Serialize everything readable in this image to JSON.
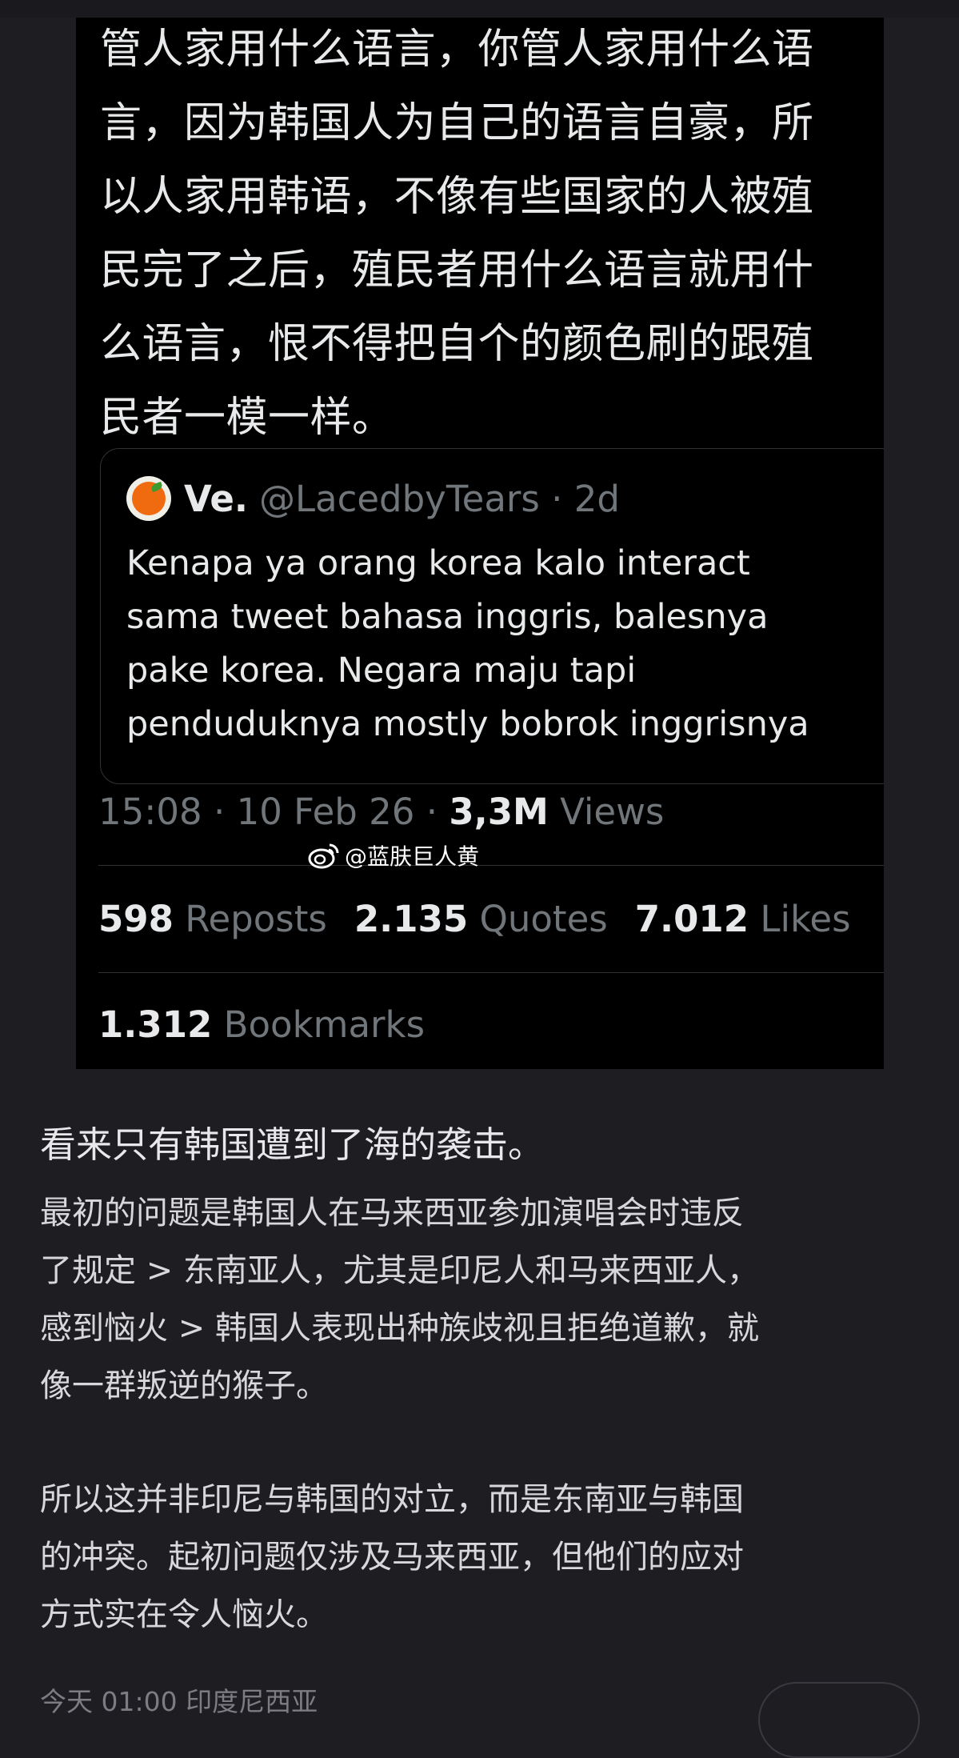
{
  "tweet": {
    "text": "管人家用什么语言，你管人家用什么语\n言，因为韩国人为自己的语言自豪，所\n以人家用韩语，不像有些国家的人被殖\n民完了之后，殖民者用什么语言就用什\n么语言，恨不得把自个的颜色刷的跟殖\n民者一模一样。",
    "quote": {
      "name": "Ve.",
      "handle": "@LacedbyTears · 2d",
      "text": "Kenapa ya orang korea kalo interact\nsama tweet bahasa inggris, balesnya\npake korea. Negara maju tapi\npenduduknya mostly bobrok inggrisnya",
      "avatar_icon": "orange-fruit-avatar"
    },
    "meta": {
      "time": "15:08 · 10 Feb 26 · ",
      "views_count": "3,3M",
      "views_label": " Views"
    },
    "stats": {
      "reposts_count": "598",
      "reposts_label": " Reposts",
      "quotes_count": "2.135",
      "quotes_label": " Quotes",
      "likes_count": "7.012",
      "likes_label": " Likes",
      "bookmarks_count": "1.312",
      "bookmarks_label": " Bookmarks"
    }
  },
  "watermark": {
    "text": "@蓝肤巨人黄",
    "icon": "weibo-icon"
  },
  "post": {
    "headline": "看来只有韩国遭到了海的袭击。",
    "paragraph1": "最初的问题是韩国人在马来西亚参加演唱会时违反\n了规定 > 东南亚人，尤其是印尼人和马来西亚人，\n感到恼火 > 韩国人表现出种族歧视且拒绝道歉，就\n像一群叛逆的猴子。",
    "paragraph2": "所以这并非印尼与韩国的对立，而是东南亚与韩国\n的冲突。起初问题仅涉及马来西亚，但他们的应对\n方式实在令人恼火。",
    "footer": "今天 01:00  印度尼西亚"
  },
  "colors": {
    "page_bg": "#1e1d22",
    "screenshot_bg": "#000000",
    "muted": "#71767b"
  }
}
